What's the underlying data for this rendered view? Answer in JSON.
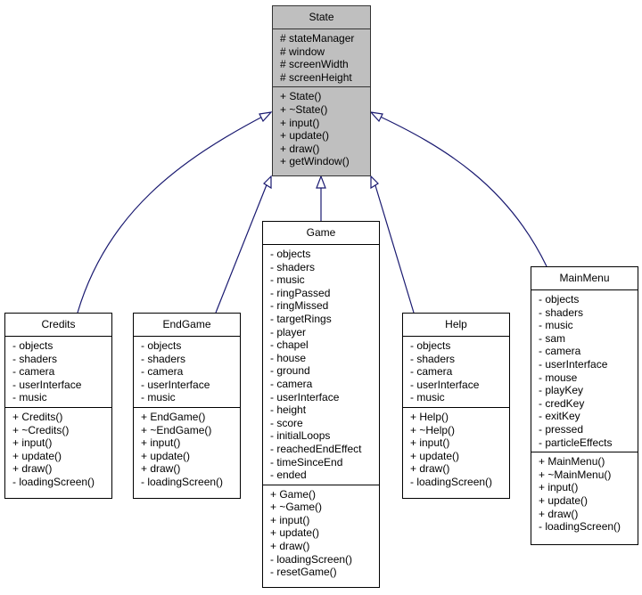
{
  "diagram": {
    "type": "uml-class-inheritance",
    "edge_color": "#191970",
    "base_fill": "#bfbfbf",
    "base_class": {
      "name": "State",
      "attributes": [
        "# stateManager",
        "# window",
        "# screenWidth",
        "# screenHeight"
      ],
      "methods": [
        "+ State()",
        "+ ~State()",
        "+ input()",
        "+ update()",
        "+ draw()",
        "+ getWindow()"
      ]
    },
    "derived_classes": [
      {
        "name": "Credits",
        "attributes": [
          "- objects",
          "- shaders",
          "- camera",
          "- userInterface",
          "- music"
        ],
        "methods": [
          "+ Credits()",
          "+ ~Credits()",
          "+ input()",
          "+ update()",
          "+ draw()",
          "- loadingScreen()"
        ]
      },
      {
        "name": "EndGame",
        "attributes": [
          "- objects",
          "- shaders",
          "- camera",
          "- userInterface",
          "- music"
        ],
        "methods": [
          "+ EndGame()",
          "+ ~EndGame()",
          "+ input()",
          "+ update()",
          "+ draw()",
          "- loadingScreen()"
        ]
      },
      {
        "name": "Game",
        "attributes": [
          "- objects",
          "- shaders",
          "- music",
          "- ringPassed",
          "- ringMissed",
          "- targetRings",
          "- player",
          "- chapel",
          "- house",
          "- ground",
          "- camera",
          "- userInterface",
          "- height",
          "- score",
          "- initialLoops",
          "- reachedEndEffect",
          "- timeSinceEnd",
          "- ended"
        ],
        "methods": [
          "+ Game()",
          "+ ~Game()",
          "+ input()",
          "+ update()",
          "+ draw()",
          "- loadingScreen()",
          "- resetGame()"
        ]
      },
      {
        "name": "Help",
        "attributes": [
          "- objects",
          "- shaders",
          "- camera",
          "- userInterface",
          "- music"
        ],
        "methods": [
          "+ Help()",
          "+ ~Help()",
          "+ input()",
          "+ update()",
          "+ draw()",
          "- loadingScreen()"
        ]
      },
      {
        "name": "MainMenu",
        "attributes": [
          "- objects",
          "- shaders",
          "- music",
          "- sam",
          "- camera",
          "- userInterface",
          "- mouse",
          "- playKey",
          "- credKey",
          "- exitKey",
          "- pressed",
          "- particleEffects"
        ],
        "methods": [
          "+ MainMenu()",
          "+ ~MainMenu()",
          "+ input()",
          "+ update()",
          "+ draw()",
          "- loadingScreen()"
        ]
      }
    ],
    "edges": [
      {
        "from": "Credits",
        "to": "State",
        "relation": "inherits"
      },
      {
        "from": "EndGame",
        "to": "State",
        "relation": "inherits"
      },
      {
        "from": "Game",
        "to": "State",
        "relation": "inherits"
      },
      {
        "from": "Help",
        "to": "State",
        "relation": "inherits"
      },
      {
        "from": "MainMenu",
        "to": "State",
        "relation": "inherits"
      }
    ]
  }
}
